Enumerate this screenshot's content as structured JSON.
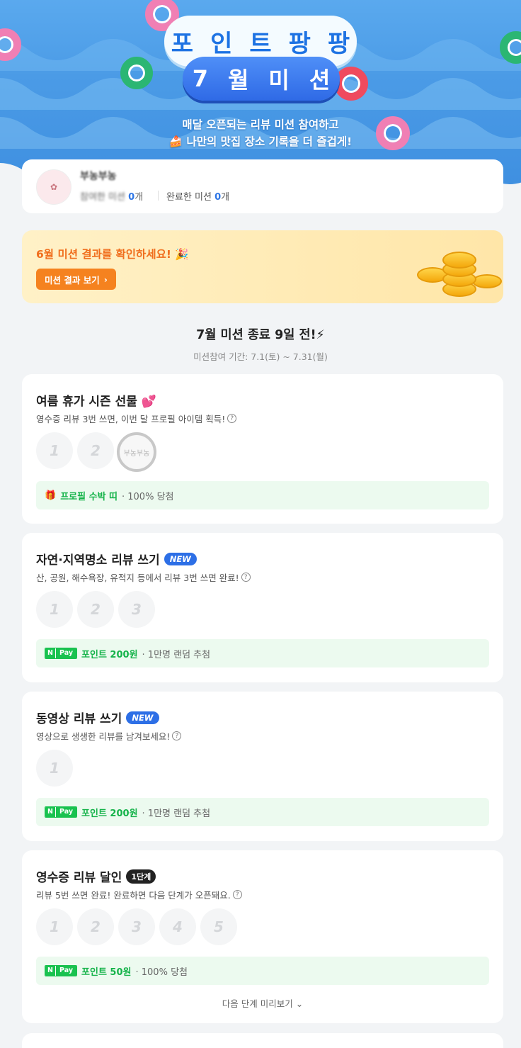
{
  "hero": {
    "title_line1": [
      "포",
      "인",
      "트",
      "팡",
      "팡"
    ],
    "title_line2": [
      "7",
      "월",
      "미",
      "션"
    ],
    "subtitle_line1": "매달 오픈되는 리뷰 미션 참여하고",
    "subtitle_line2": "나만의 맛집 장소 기록을 더 즐겁게!"
  },
  "profile": {
    "nickname": "부농부농",
    "stat1_label": "참여한 미션",
    "stat1_value": "0",
    "stat1_suffix": "개",
    "stat2_label": "완료한 미션",
    "stat2_value": "0",
    "stat2_suffix": "개"
  },
  "banner": {
    "title": "6월 미션 결과를 확인하세요! 🎉",
    "button_label": "미션 결과 보기",
    "button_arrow": "›"
  },
  "period": {
    "title": "7월 미션 종료 9일 전!⚡",
    "subtitle": "미션참여 기간: 7.1(토) ~ 7.31(월)"
  },
  "missions": [
    {
      "title": "여름 휴가 시즌 선물 💕",
      "desc": "영수증 리뷰 3번 쓰면, 이번 달 프로필 아이템 획득!",
      "steps": [
        "1",
        "2"
      ],
      "stamp_text": "부농부농",
      "reward_highlight": "프로필 수박 띠",
      "reward_rest": "· 100% 당첨"
    },
    {
      "title": "자연·지역명소 리뷰 쓰기",
      "badge": "NEW",
      "desc": "산, 공원, 해수욕장, 유적지 등에서 리뷰 3번 쓰면 완료!",
      "steps": [
        "1",
        "2",
        "3"
      ],
      "pay_n": "N",
      "pay_label": "Pay",
      "reward_highlight": "포인트 200원",
      "reward_rest": "· 1만명 랜덤 추첨"
    },
    {
      "title": "동영상 리뷰 쓰기",
      "badge": "NEW",
      "desc": "영상으로 생생한 리뷰를 남겨보세요!",
      "steps": [
        "1"
      ],
      "pay_n": "N",
      "pay_label": "Pay",
      "reward_highlight": "포인트 200원",
      "reward_rest": "· 1만명 랜덤 추첨"
    },
    {
      "title": "영수증 리뷰 달인",
      "badge": "1단계",
      "desc": "리뷰 5번 쓰면 완료! 완료하면 다음 단계가 오픈돼요.",
      "steps": [
        "1",
        "2",
        "3",
        "4",
        "5"
      ],
      "pay_n": "N",
      "pay_label": "Pay",
      "reward_highlight": "포인트 50원",
      "reward_rest": "· 100% 당첨",
      "preview_label": "다음 단계 미리보기 ⌄"
    }
  ],
  "colors": {
    "hero_blue": "#4b9be6",
    "accent_blue": "#2e76e6",
    "orange": "#f5821f",
    "green": "#15b34a",
    "reward_bg": "#ecfaef"
  }
}
